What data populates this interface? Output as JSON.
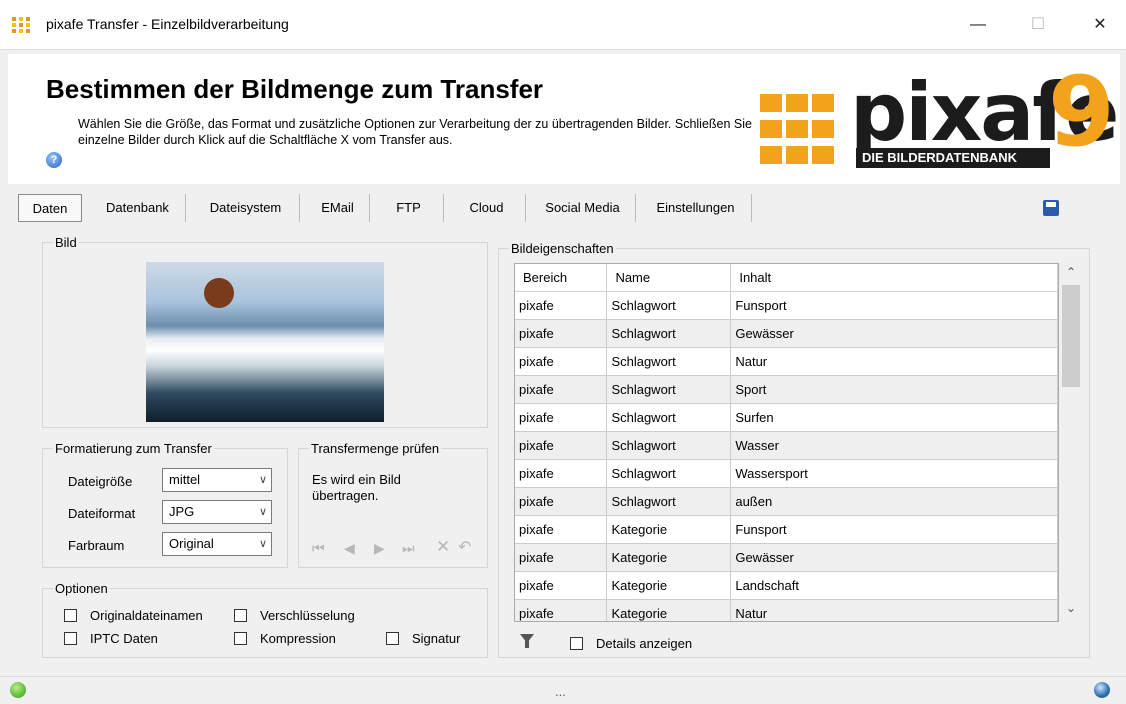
{
  "window": {
    "title": "pixafe Transfer - Einzelbildverarbeitung",
    "minimize": "—",
    "maximize": "☐",
    "close": "✕"
  },
  "header": {
    "title": "Bestimmen der Bildmenge zum Transfer",
    "description": "Wählen Sie die Größe, das Format und zusätzliche Optionen zur Verarbeitung der zu übertragenden Bilder. Schließen Sie einzelne Bilder durch Klick auf die Schaltfläche X vom Transfer aus.",
    "help": "?",
    "logo_word": "pixafe",
    "logo_number": "9",
    "logo_subtitle": "DIE BILDERDATENBANK"
  },
  "tabs": [
    "Daten",
    "Datenbank",
    "Dateisystem",
    "EMail",
    "FTP",
    "Cloud",
    "Social Media",
    "Einstellungen"
  ],
  "bild": {
    "label": "Bild"
  },
  "formatierung": {
    "label": "Formatierung zum Transfer",
    "dateigroesse_label": "Dateigröße",
    "dateigroesse_value": "mittel",
    "dateiformat_label": "Dateiformat",
    "dateiformat_value": "JPG",
    "farbraum_label": "Farbraum",
    "farbraum_value": "Original"
  },
  "transfermenge": {
    "label": "Transfermenge prüfen",
    "text": "Es wird ein Bild übertragen."
  },
  "optionen": {
    "label": "Optionen",
    "originaldateinamen": "Originaldateinamen",
    "verschluesselung": "Verschlüsselung",
    "iptc": "IPTC Daten",
    "kompression": "Kompression",
    "signatur": "Signatur"
  },
  "eigenschaften": {
    "label": "Bildeigenschaften",
    "columns": [
      "Bereich",
      "Name",
      "Inhalt"
    ],
    "rows": [
      [
        "pixafe",
        "Schlagwort",
        "Funsport"
      ],
      [
        "pixafe",
        "Schlagwort",
        "Gewässer"
      ],
      [
        "pixafe",
        "Schlagwort",
        "Natur"
      ],
      [
        "pixafe",
        "Schlagwort",
        "Sport"
      ],
      [
        "pixafe",
        "Schlagwort",
        "Surfen"
      ],
      [
        "pixafe",
        "Schlagwort",
        "Wasser"
      ],
      [
        "pixafe",
        "Schlagwort",
        "Wassersport"
      ],
      [
        "pixafe",
        "Schlagwort",
        "außen"
      ],
      [
        "pixafe",
        "Kategorie",
        "Funsport"
      ],
      [
        "pixafe",
        "Kategorie",
        "Gewässer"
      ],
      [
        "pixafe",
        "Kategorie",
        "Landschaft"
      ],
      [
        "pixafe",
        "Kategorie",
        "Natur"
      ]
    ],
    "details_label": "Details anzeigen"
  },
  "statusbar": {
    "text": "..."
  }
}
